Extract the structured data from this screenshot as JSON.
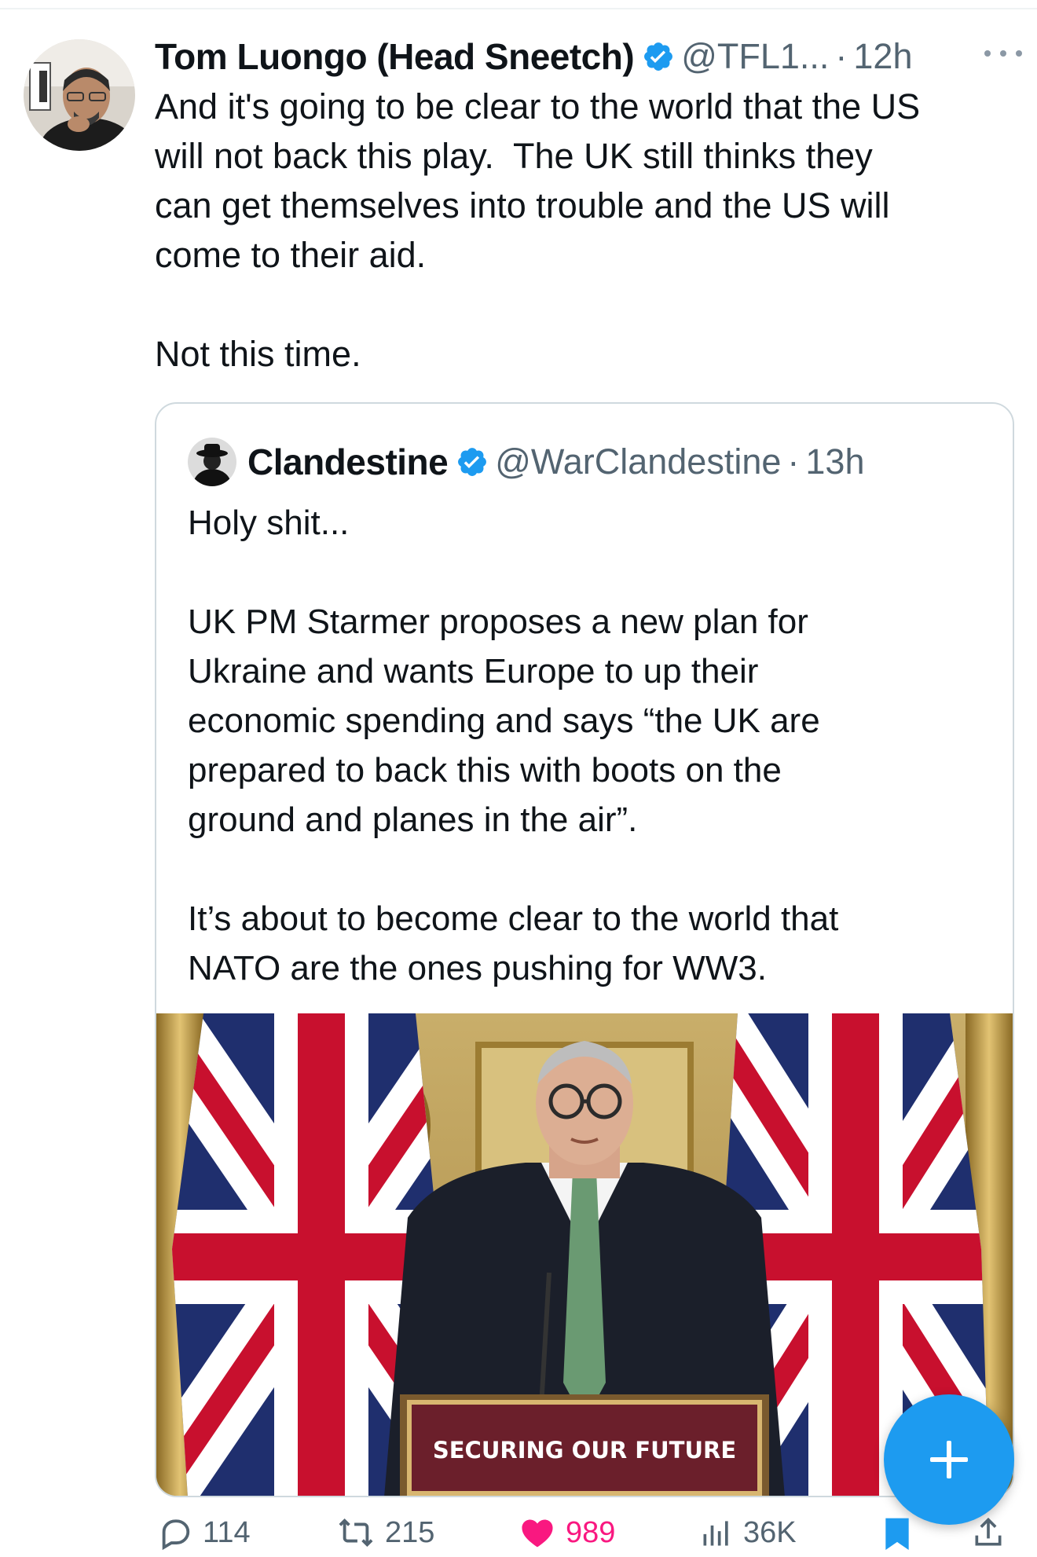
{
  "tweet": {
    "author_name": "Tom Luongo (Head Sneetch)",
    "handle": "@TFL1...",
    "separator": "·",
    "time": "12h",
    "text": "And it's going to be clear to the world that the US\nwill not back this play.  The UK still thinks they\ncan get themselves into trouble and the US will\ncome to their aid.\n\nNot this time."
  },
  "quote": {
    "author_name": "Clandestine",
    "handle": "@WarClandestine",
    "separator": "·",
    "time": "13h",
    "text": "Holy shit...\n\nUK PM Starmer proposes a new plan for\nUkraine and wants Europe to up their\neconomic spending and says “the UK are\nprepared to back this with boots on the\nground and planes in the air”.\n\nIt’s about to become clear to the world that\nNATO are the ones pushing for WW3.",
    "image": {
      "podium_text": "SECURING OUR FUTURE"
    }
  },
  "actions": {
    "replies": "114",
    "reposts": "215",
    "likes": "989",
    "views": "36K"
  },
  "colors": {
    "verified_blue": "#1d9bf0",
    "secondary_text": "#536471",
    "like_pink": "#f91880",
    "fab_blue": "#1d9bf0"
  },
  "icons": [
    "more-icon",
    "verified-icon",
    "reply-icon",
    "repost-icon",
    "like-icon",
    "views-icon",
    "bookmark-icon",
    "share-icon",
    "plus-icon"
  ]
}
